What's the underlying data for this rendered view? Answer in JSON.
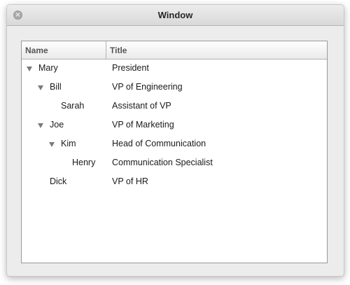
{
  "window": {
    "title": "Window"
  },
  "table": {
    "columns": {
      "name": "Name",
      "title": "Title"
    },
    "rows": [
      {
        "name": "Mary",
        "title": "President",
        "level": 0,
        "expanded": true
      },
      {
        "name": "Bill",
        "title": "VP of Engineering",
        "level": 1,
        "expanded": true
      },
      {
        "name": "Sarah",
        "title": "Assistant of VP",
        "level": 2,
        "expanded": false
      },
      {
        "name": "Joe",
        "title": "VP of Marketing",
        "level": 1,
        "expanded": true
      },
      {
        "name": "Kim",
        "title": "Head of Communication",
        "level": 2,
        "expanded": true
      },
      {
        "name": "Henry",
        "title": "Communication Specialist",
        "level": 3,
        "expanded": false
      },
      {
        "name": "Dick",
        "title": "VP of HR",
        "level": 1,
        "expanded": false
      }
    ]
  },
  "icons": {
    "close": "close-icon",
    "disclosure": "disclosure-triangle-icon"
  }
}
